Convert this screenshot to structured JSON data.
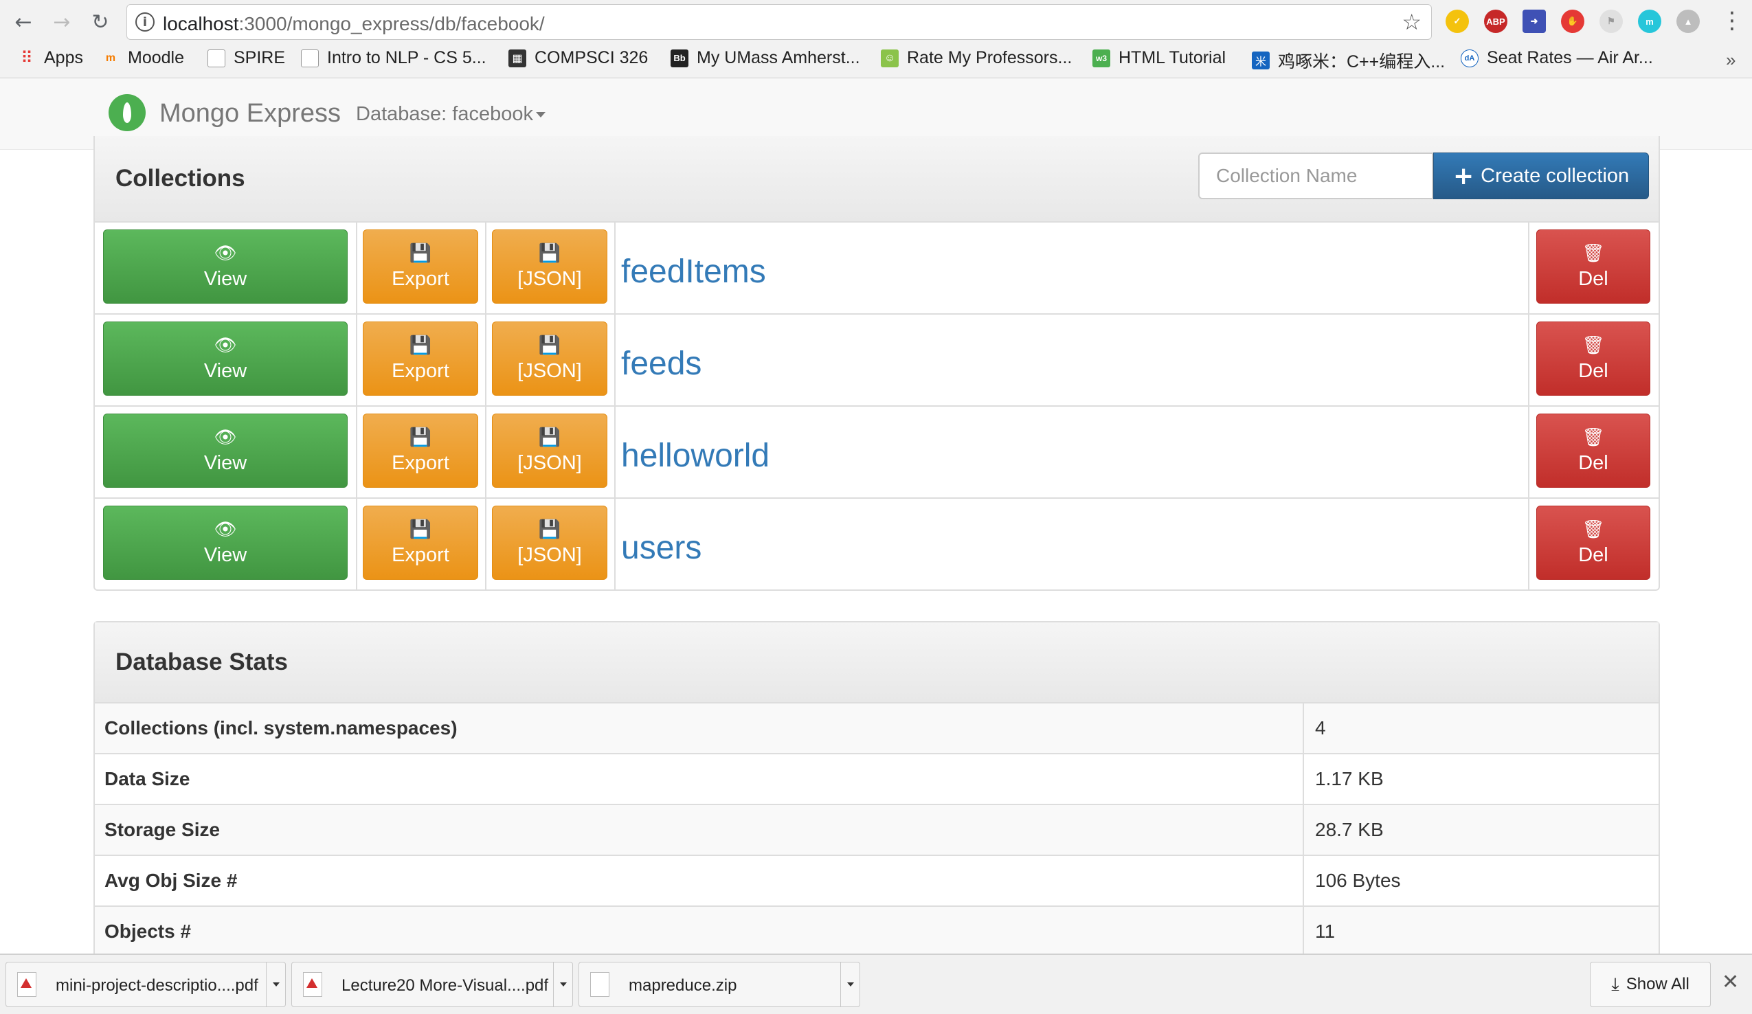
{
  "browser": {
    "url_host": "localhost",
    "url_path": ":3000/mongo_express/db/facebook/",
    "bookmarks": [
      {
        "label": "Apps",
        "icon": "apps-grid-icon"
      },
      {
        "label": "Moodle",
        "icon": "moodle-icon"
      },
      {
        "label": "SPIRE",
        "icon": "page-icon"
      },
      {
        "label": "Intro to NLP - CS 5...",
        "icon": "page-icon"
      },
      {
        "label": "COMPSCI 326",
        "icon": "github-icon"
      },
      {
        "label": "My UMass Amherst...",
        "icon": "blackboard-icon"
      },
      {
        "label": "Rate My Professors...",
        "icon": "rmp-icon"
      },
      {
        "label": "HTML Tutorial",
        "icon": "w3schools-icon"
      },
      {
        "label": "鸡啄米：C++编程入...",
        "icon": "jizhuomi-icon"
      },
      {
        "label": "Seat Rates — Air Ar...",
        "icon": "seatrates-icon"
      }
    ]
  },
  "navbar": {
    "brand": "Mongo Express",
    "database_dropdown": "Database: facebook"
  },
  "collections_panel": {
    "title": "Collections",
    "input_placeholder": "Collection Name",
    "create_label": "Create collection",
    "view_label": "View",
    "export_label": "Export",
    "json_label": "[JSON]",
    "del_label": "Del",
    "collections": [
      "feedItems",
      "feeds",
      "helloworld",
      "users"
    ]
  },
  "stats_panel": {
    "title": "Database Stats",
    "rows": [
      {
        "label": "Collections (incl. system.namespaces)",
        "value": "4"
      },
      {
        "label": "Data Size",
        "value": "1.17 KB"
      },
      {
        "label": "Storage Size",
        "value": "28.7 KB"
      },
      {
        "label": "Avg Obj Size #",
        "value": "106 Bytes"
      },
      {
        "label": "Objects #",
        "value": "11"
      }
    ]
  },
  "downloads": {
    "items": [
      {
        "name": "mini-project-descriptio....pdf",
        "type": "pdf"
      },
      {
        "name": "Lecture20 More-Visual....pdf",
        "type": "pdf"
      },
      {
        "name": "mapreduce.zip",
        "type": "zip"
      }
    ],
    "show_all": "Show All"
  },
  "colors": {
    "view": "#5cb85c",
    "export": "#f0ad4e",
    "delete": "#d9534f",
    "primary": "#337ab7"
  }
}
